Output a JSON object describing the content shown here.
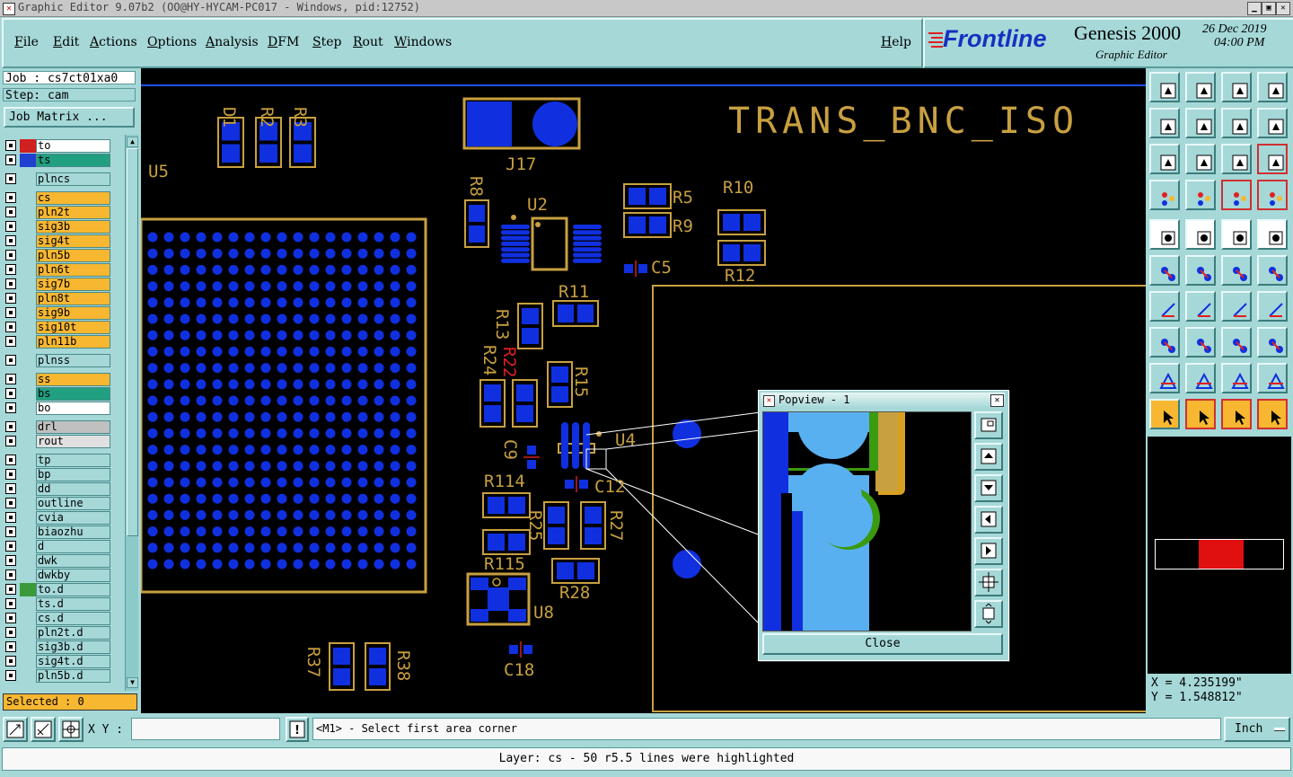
{
  "window": {
    "title": "Graphic Editor 9.07b2 (OO@HY-HYCAM-PC017 - Windows, pid:12752)"
  },
  "menu": {
    "items": [
      "File",
      "Edit",
      "Actions",
      "Options",
      "Analysis",
      "DFM",
      "Step",
      "Rout",
      "Windows"
    ],
    "help": "Help"
  },
  "logo": {
    "brand": "Frontline",
    "product": "Genesis 2000",
    "subtitle": "Graphic Editor",
    "date": "26 Dec 2019",
    "time": "04:00 PM"
  },
  "job": {
    "job_label": "Job : cs7ct01xa0",
    "step_label": "Step: cam",
    "matrix_button": "Job Matrix ..."
  },
  "layers": [
    {
      "name": "to",
      "color": "#ffffff",
      "swatch": "#d02020"
    },
    {
      "name": "ts",
      "color": "#20a080",
      "swatch": "#2040d0"
    },
    {
      "name": "plncs",
      "color": "#a6d8d8",
      "swatch": ""
    },
    {
      "name": "cs",
      "color": "#f7b731",
      "swatch": ""
    },
    {
      "name": "pln2t",
      "color": "#f7b731",
      "swatch": ""
    },
    {
      "name": "sig3b",
      "color": "#f7b731",
      "swatch": ""
    },
    {
      "name": "sig4t",
      "color": "#f7b731",
      "swatch": ""
    },
    {
      "name": "pln5b",
      "color": "#f7b731",
      "swatch": ""
    },
    {
      "name": "pln6t",
      "color": "#f7b731",
      "swatch": ""
    },
    {
      "name": "sig7b",
      "color": "#f7b731",
      "swatch": ""
    },
    {
      "name": "pln8t",
      "color": "#f7b731",
      "swatch": ""
    },
    {
      "name": "sig9b",
      "color": "#f7b731",
      "swatch": ""
    },
    {
      "name": "sig10t",
      "color": "#f7b731",
      "swatch": ""
    },
    {
      "name": "pln11b",
      "color": "#f7b731",
      "swatch": ""
    },
    {
      "name": "plnss",
      "color": "#a6d8d8",
      "swatch": ""
    },
    {
      "name": "ss",
      "color": "#f7b731",
      "swatch": ""
    },
    {
      "name": "bs",
      "color": "#20a080",
      "swatch": ""
    },
    {
      "name": "bo",
      "color": "#ffffff",
      "swatch": ""
    },
    {
      "name": "drl",
      "color": "#c0c0c0",
      "swatch": ""
    },
    {
      "name": "rout",
      "color": "#e0e0e0",
      "swatch": ""
    },
    {
      "name": "tp",
      "color": "#a6d8d8",
      "swatch": ""
    },
    {
      "name": "bp",
      "color": "#a6d8d8",
      "swatch": ""
    },
    {
      "name": "dd",
      "color": "#a6d8d8",
      "swatch": ""
    },
    {
      "name": "outline",
      "color": "#a6d8d8",
      "swatch": ""
    },
    {
      "name": "cvia",
      "color": "#a6d8d8",
      "swatch": ""
    },
    {
      "name": "biaozhu",
      "color": "#a6d8d8",
      "swatch": ""
    },
    {
      "name": "d",
      "color": "#a6d8d8",
      "swatch": ""
    },
    {
      "name": "dwk",
      "color": "#a6d8d8",
      "swatch": ""
    },
    {
      "name": "dwkby",
      "color": "#a6d8d8",
      "swatch": ""
    },
    {
      "name": "to.d",
      "color": "#a6d8d8",
      "swatch": "#3a9a3a"
    },
    {
      "name": "ts.d",
      "color": "#a6d8d8",
      "swatch": ""
    },
    {
      "name": "cs.d",
      "color": "#a6d8d8",
      "swatch": ""
    },
    {
      "name": "pln2t.d",
      "color": "#a6d8d8",
      "swatch": ""
    },
    {
      "name": "sig3b.d",
      "color": "#a6d8d8",
      "swatch": ""
    },
    {
      "name": "sig4t.d",
      "color": "#a6d8d8",
      "swatch": ""
    },
    {
      "name": "pln5b.d",
      "color": "#a6d8d8",
      "swatch": ""
    }
  ],
  "selected": "Selected : 0",
  "board": {
    "title": "TRANS_BNC_ISO",
    "labels": [
      "D1",
      "R2",
      "R3",
      "U5",
      "J17",
      "R8",
      "U2",
      "R5",
      "R10",
      "R9",
      "C5",
      "R12",
      "R11",
      "R13",
      "R22",
      "R24",
      "R15",
      "U4",
      "C9",
      "C12",
      "R114",
      "R25",
      "R27",
      "R115",
      "R28",
      "U8",
      "R37",
      "R38",
      "C18"
    ]
  },
  "popview": {
    "title": "Popview - 1",
    "close_label": "Close"
  },
  "coords": {
    "x": "X = 4.235199\"",
    "y": "Y = 1.548812\""
  },
  "commandbar": {
    "xy_label": "X Y :",
    "xy_value": "",
    "prompt": "<M1> - Select first area corner",
    "units": "Inch"
  },
  "status": "Layer: cs - 50 r5.5 lines were highlighted",
  "colors": {
    "background": "#a6d8d8",
    "pad": "#1030e0",
    "copper": "#c8a040",
    "highlight": "#f7b731"
  }
}
